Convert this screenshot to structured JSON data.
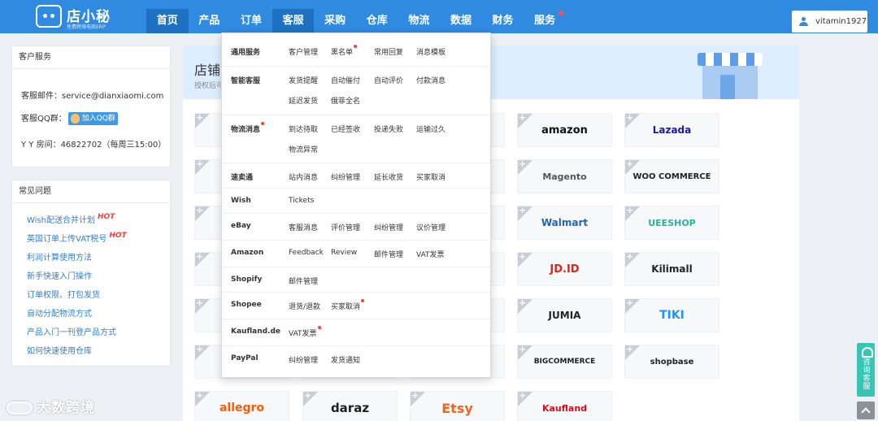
{
  "logo": {
    "title": "店小秘",
    "subtitle": "免费跨境电商ERP"
  },
  "nav": [
    {
      "label": "首页",
      "state": "active",
      "dot": false
    },
    {
      "label": "产品",
      "state": "",
      "dot": false
    },
    {
      "label": "订单",
      "state": "",
      "dot": false
    },
    {
      "label": "客服",
      "state": "open",
      "dot": false
    },
    {
      "label": "采购",
      "state": "",
      "dot": false
    },
    {
      "label": "仓库",
      "state": "",
      "dot": false
    },
    {
      "label": "物流",
      "state": "",
      "dot": false
    },
    {
      "label": "数据",
      "state": "",
      "dot": false
    },
    {
      "label": "财务",
      "state": "",
      "dot": false
    },
    {
      "label": "服务",
      "state": "",
      "dot": true
    }
  ],
  "user": {
    "name": "vitamin1927"
  },
  "cs": {
    "title": "客户服务",
    "email": "客服邮件：service@dianxiaomi.com",
    "qq_label": "客服QQ群：",
    "qq_button": "加入QQ群",
    "yy": "Y Y 房间：46822702（每周三15:00）"
  },
  "faq": {
    "title": "常见问题",
    "items": [
      {
        "text": "Wish配送合并计划",
        "hot": "HOT"
      },
      {
        "text": "英国订单上传VAT税号",
        "hot": "HOT"
      },
      {
        "text": "利润计算使用方法",
        "hot": ""
      },
      {
        "text": "新手快速入门操作",
        "hot": ""
      },
      {
        "text": "订单权限、打包发货",
        "hot": ""
      },
      {
        "text": "自动分配物流方式",
        "hot": ""
      },
      {
        "text": "产品入门一刊登产品方式",
        "hot": ""
      },
      {
        "text": "如何快速使用仓库",
        "hot": ""
      }
    ]
  },
  "banner": {
    "title": "店铺",
    "subtitle": "授权后可"
  },
  "platforms": [
    {
      "name": "amazon",
      "color": "#111111"
    },
    {
      "name": "Lazada",
      "color": "#1a1aa6"
    },
    {
      "name": "Magento",
      "color": "#555555"
    },
    {
      "name": "WOO COMMERCE",
      "color": "#222222"
    },
    {
      "name": "Walmart",
      "color": "#1f64b8"
    },
    {
      "name": "UEESHOP",
      "color": "#27b39b"
    },
    {
      "name": "JD.ID",
      "color": "#e1251b"
    },
    {
      "name": "Kilimall",
      "color": "#222222"
    },
    {
      "name": "JUMIA",
      "color": "#222222"
    },
    {
      "name": "TIKI",
      "color": "#1a94ff"
    },
    {
      "name": "BIGCOMMERCE",
      "color": "#222222"
    },
    {
      "name": "shopbase",
      "color": "#222222"
    },
    {
      "name": "allegro",
      "color": "#ff5a00"
    },
    {
      "name": "daraz",
      "color": "#202020"
    },
    {
      "name": "Etsy",
      "color": "#f1641e"
    },
    {
      "name": "Kaufland",
      "color": "#e10915"
    }
  ],
  "menu": [
    {
      "category": "通用服务",
      "dot": false,
      "links": [
        {
          "text": "客户管理",
          "dot": false
        },
        {
          "text": "黑名单",
          "dot": true
        },
        {
          "text": "常用回复",
          "dot": false
        },
        {
          "text": "消息模板",
          "dot": false
        }
      ]
    },
    {
      "category": "智能客服",
      "dot": false,
      "links": [
        {
          "text": "发货提醒",
          "dot": false
        },
        {
          "text": "自动催付",
          "dot": false
        },
        {
          "text": "自动评价",
          "dot": false
        },
        {
          "text": "付款消息",
          "dot": false
        },
        {
          "text": "延迟发货",
          "dot": false
        },
        {
          "text": "俄菲全名",
          "dot": false
        }
      ]
    },
    {
      "category": "物流消息",
      "dot": true,
      "links": [
        {
          "text": "到达待取",
          "dot": false
        },
        {
          "text": "已经签收",
          "dot": false
        },
        {
          "text": "投递失败",
          "dot": false
        },
        {
          "text": "运输过久",
          "dot": false
        },
        {
          "text": "物流异常",
          "dot": false
        }
      ]
    },
    {
      "category": "速卖通",
      "dot": false,
      "links": [
        {
          "text": "站内消息",
          "dot": false
        },
        {
          "text": "纠纷管理",
          "dot": false
        },
        {
          "text": "延长收货",
          "dot": false
        },
        {
          "text": "买家取消",
          "dot": false
        }
      ]
    },
    {
      "category": "Wish",
      "dot": false,
      "links": [
        {
          "text": "Tickets",
          "dot": false
        }
      ]
    },
    {
      "category": "eBay",
      "dot": false,
      "links": [
        {
          "text": "客服消息",
          "dot": false
        },
        {
          "text": "评价管理",
          "dot": false
        },
        {
          "text": "纠纷管理",
          "dot": false
        },
        {
          "text": "议价管理",
          "dot": false
        }
      ]
    },
    {
      "category": "Amazon",
      "dot": false,
      "links": [
        {
          "text": "Feedback",
          "dot": false
        },
        {
          "text": "Review",
          "dot": false
        },
        {
          "text": "邮件管理",
          "dot": false
        },
        {
          "text": "VAT发票",
          "dot": false
        }
      ]
    },
    {
      "category": "Shopify",
      "dot": false,
      "links": [
        {
          "text": "邮件管理",
          "dot": false
        }
      ]
    },
    {
      "category": "Shopee",
      "dot": false,
      "links": [
        {
          "text": "退货/退款",
          "dot": false
        },
        {
          "text": "买家取消",
          "dot": true
        }
      ]
    },
    {
      "category": "Kaufland.de",
      "dot": false,
      "links": [
        {
          "text": "VAT发票",
          "dot": true
        }
      ]
    },
    {
      "category": "PayPal",
      "dot": false,
      "links": [
        {
          "text": "纠纷管理",
          "dot": false
        },
        {
          "text": "发货通知",
          "dot": false
        }
      ]
    }
  ],
  "float_button": "咨询客服",
  "watermark": "大数跨境"
}
